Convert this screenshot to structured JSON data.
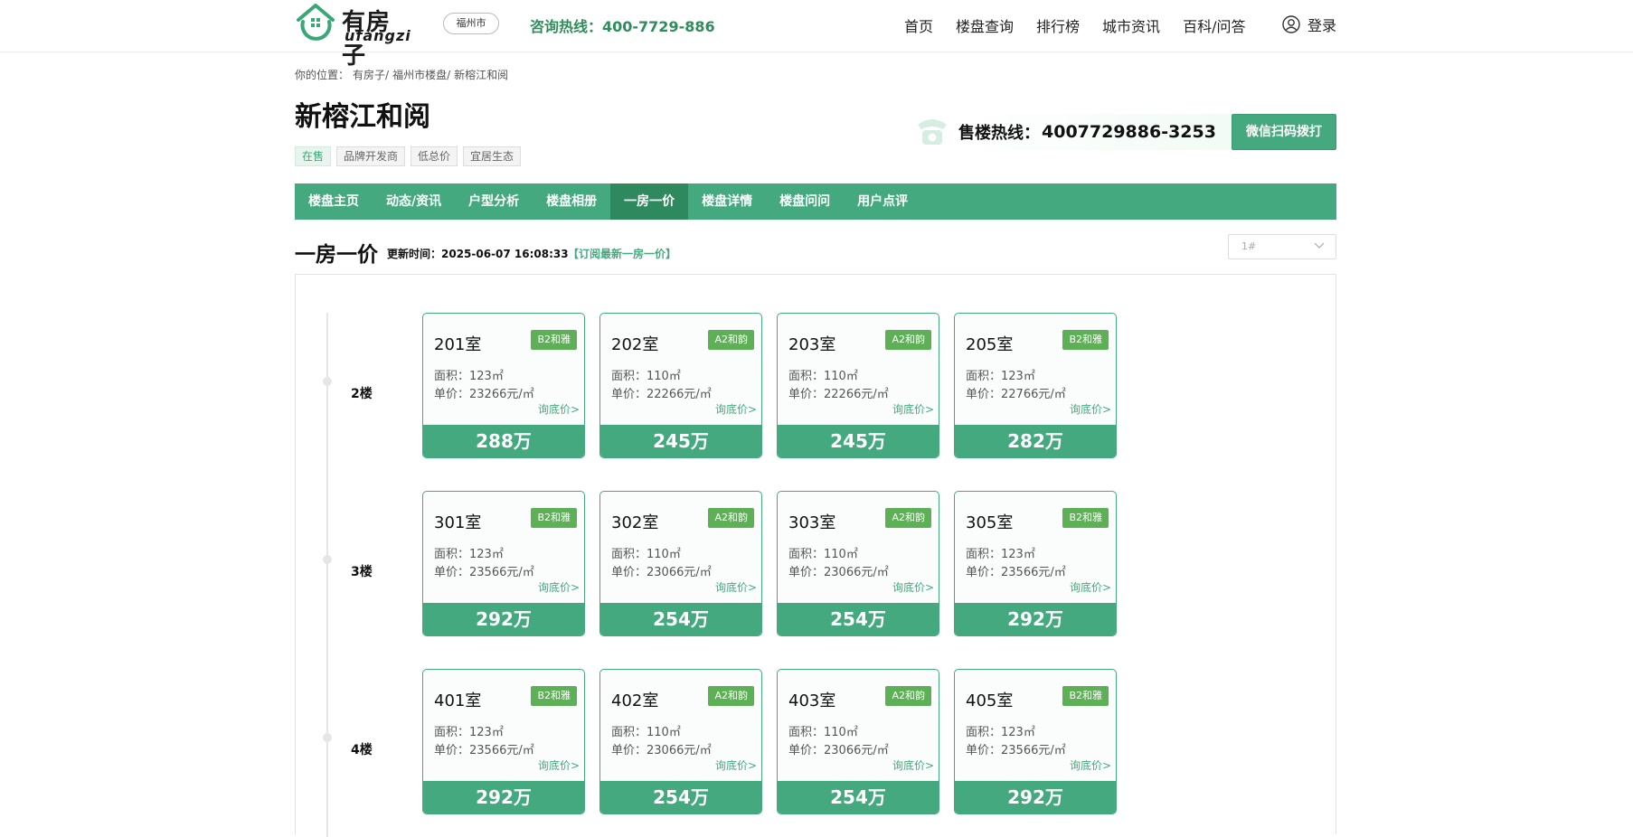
{
  "header": {
    "logo_cn": "有房子",
    "logo_en": "ufangzi",
    "city": "福州市",
    "hotline": "咨询热线：400-7729-886",
    "nav": [
      "首页",
      "楼盘查询",
      "排行榜",
      "城市资讯",
      "百科/问答"
    ],
    "login": "登录"
  },
  "breadcrumb": [
    "你的位置：",
    "有房子/",
    "福州市楼盘/",
    "新榕江和阅"
  ],
  "title": "新榕江和阅",
  "tags": [
    "在售",
    "品牌开发商",
    "低总价",
    "宜居生态"
  ],
  "sales": {
    "label": "售楼热线：",
    "number": "4007729886-3253",
    "wechat_btn": "微信扫码拨打"
  },
  "tabs": [
    "楼盘主页",
    "动态/资讯",
    "户型分析",
    "楼盘相册",
    "一房一价",
    "楼盘详情",
    "楼盘问问",
    "用户点评"
  ],
  "active_tab": 4,
  "section": {
    "title": "一房一价",
    "updated": "更新时间：2025-06-07 16:08:33",
    "subscribe": "【订阅最新一房一价】",
    "building_select": "1#"
  },
  "floors": [
    {
      "label": "2楼",
      "rooms": [
        {
          "no": "201室",
          "type": "B2和雅",
          "area": "面积：123㎡",
          "price": "单价：23266元/㎡",
          "ask": "询底价>",
          "total": "288万"
        },
        {
          "no": "202室",
          "type": "A2和韵",
          "area": "面积：110㎡",
          "price": "单价：22266元/㎡",
          "ask": "询底价>",
          "total": "245万"
        },
        {
          "no": "203室",
          "type": "A2和韵",
          "area": "面积：110㎡",
          "price": "单价：22266元/㎡",
          "ask": "询底价>",
          "total": "245万"
        },
        {
          "no": "205室",
          "type": "B2和雅",
          "area": "面积：123㎡",
          "price": "单价：22766元/㎡",
          "ask": "询底价>",
          "total": "282万"
        }
      ]
    },
    {
      "label": "3楼",
      "rooms": [
        {
          "no": "301室",
          "type": "B2和雅",
          "area": "面积：123㎡",
          "price": "单价：23566元/㎡",
          "ask": "询底价>",
          "total": "292万"
        },
        {
          "no": "302室",
          "type": "A2和韵",
          "area": "面积：110㎡",
          "price": "单价：23066元/㎡",
          "ask": "询底价>",
          "total": "254万"
        },
        {
          "no": "303室",
          "type": "A2和韵",
          "area": "面积：110㎡",
          "price": "单价：23066元/㎡",
          "ask": "询底价>",
          "total": "254万"
        },
        {
          "no": "305室",
          "type": "B2和雅",
          "area": "面积：123㎡",
          "price": "单价：23566元/㎡",
          "ask": "询底价>",
          "total": "292万"
        }
      ]
    },
    {
      "label": "4楼",
      "rooms": [
        {
          "no": "401室",
          "type": "B2和雅",
          "area": "面积：123㎡",
          "price": "单价：23566元/㎡",
          "ask": "询底价>",
          "total": "292万"
        },
        {
          "no": "402室",
          "type": "A2和韵",
          "area": "面积：110㎡",
          "price": "单价：23066元/㎡",
          "ask": "询底价>",
          "total": "254万"
        },
        {
          "no": "403室",
          "type": "A2和韵",
          "area": "面积：110㎡",
          "price": "单价：23066元/㎡",
          "ask": "询底价>",
          "total": "254万"
        },
        {
          "no": "405室",
          "type": "B2和雅",
          "area": "面积：123㎡",
          "price": "单价：23566元/㎡",
          "ask": "询底价>",
          "total": "292万"
        }
      ]
    }
  ]
}
